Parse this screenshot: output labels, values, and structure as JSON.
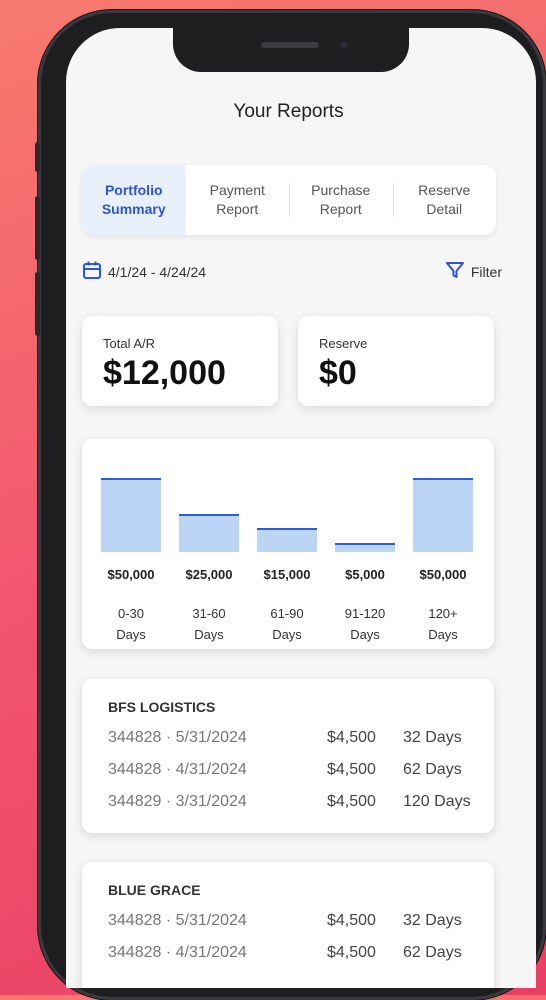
{
  "header": {
    "title": "Your Reports"
  },
  "tabs": [
    {
      "label_line1": "Portfolio",
      "label_line2": "Summary"
    },
    {
      "label_line1": "Payment",
      "label_line2": "Report"
    },
    {
      "label_line1": "Purchase",
      "label_line2": "Report"
    },
    {
      "label_line1": "Reserve",
      "label_line2": "Detail"
    }
  ],
  "date_range": "4/1/24 - 4/24/24",
  "filter_label": "Filter",
  "summary": {
    "total_ar": {
      "label": "Total A/R",
      "value": "$12,000"
    },
    "reserve": {
      "label": "Reserve",
      "value": "$0"
    }
  },
  "chart_data": {
    "type": "bar",
    "categories": [
      "0-30 Days",
      "31-60 Days",
      "61-90 Days",
      "91-120 Days",
      "120+ Days"
    ],
    "values": [
      50000,
      25000,
      15000,
      5000,
      50000
    ],
    "value_labels": [
      "$50,000",
      "$25,000",
      "$15,000",
      "$5,000",
      "$50,000"
    ],
    "category_lines": [
      [
        "0-30",
        "Days"
      ],
      [
        "31-60",
        "Days"
      ],
      [
        "61-90",
        "Days"
      ],
      [
        "91-120",
        "Days"
      ],
      [
        "120+",
        "Days"
      ]
    ]
  },
  "companies": [
    {
      "name": "BFS LOGISTICS",
      "rows": [
        {
          "invoice": "344828 · 5/31/2024",
          "amount": "$4,500",
          "age": "32 Days"
        },
        {
          "invoice": "344828 · 4/31/2024",
          "amount": "$4,500",
          "age": "62 Days"
        },
        {
          "invoice": "344829 · 3/31/2024",
          "amount": "$4,500",
          "age": "120 Days"
        }
      ]
    },
    {
      "name": "BLUE GRACE",
      "rows": [
        {
          "invoice": "344828 · 5/31/2024",
          "amount": "$4,500",
          "age": "32 Days"
        },
        {
          "invoice": "344828 · 4/31/2024",
          "amount": "$4,500",
          "age": "62 Days"
        }
      ]
    }
  ],
  "colors": {
    "accent": "#2d56d0",
    "bar_fill": "#bcd5f4",
    "bar_line": "#2b5fd9",
    "background": "#f1536f"
  }
}
